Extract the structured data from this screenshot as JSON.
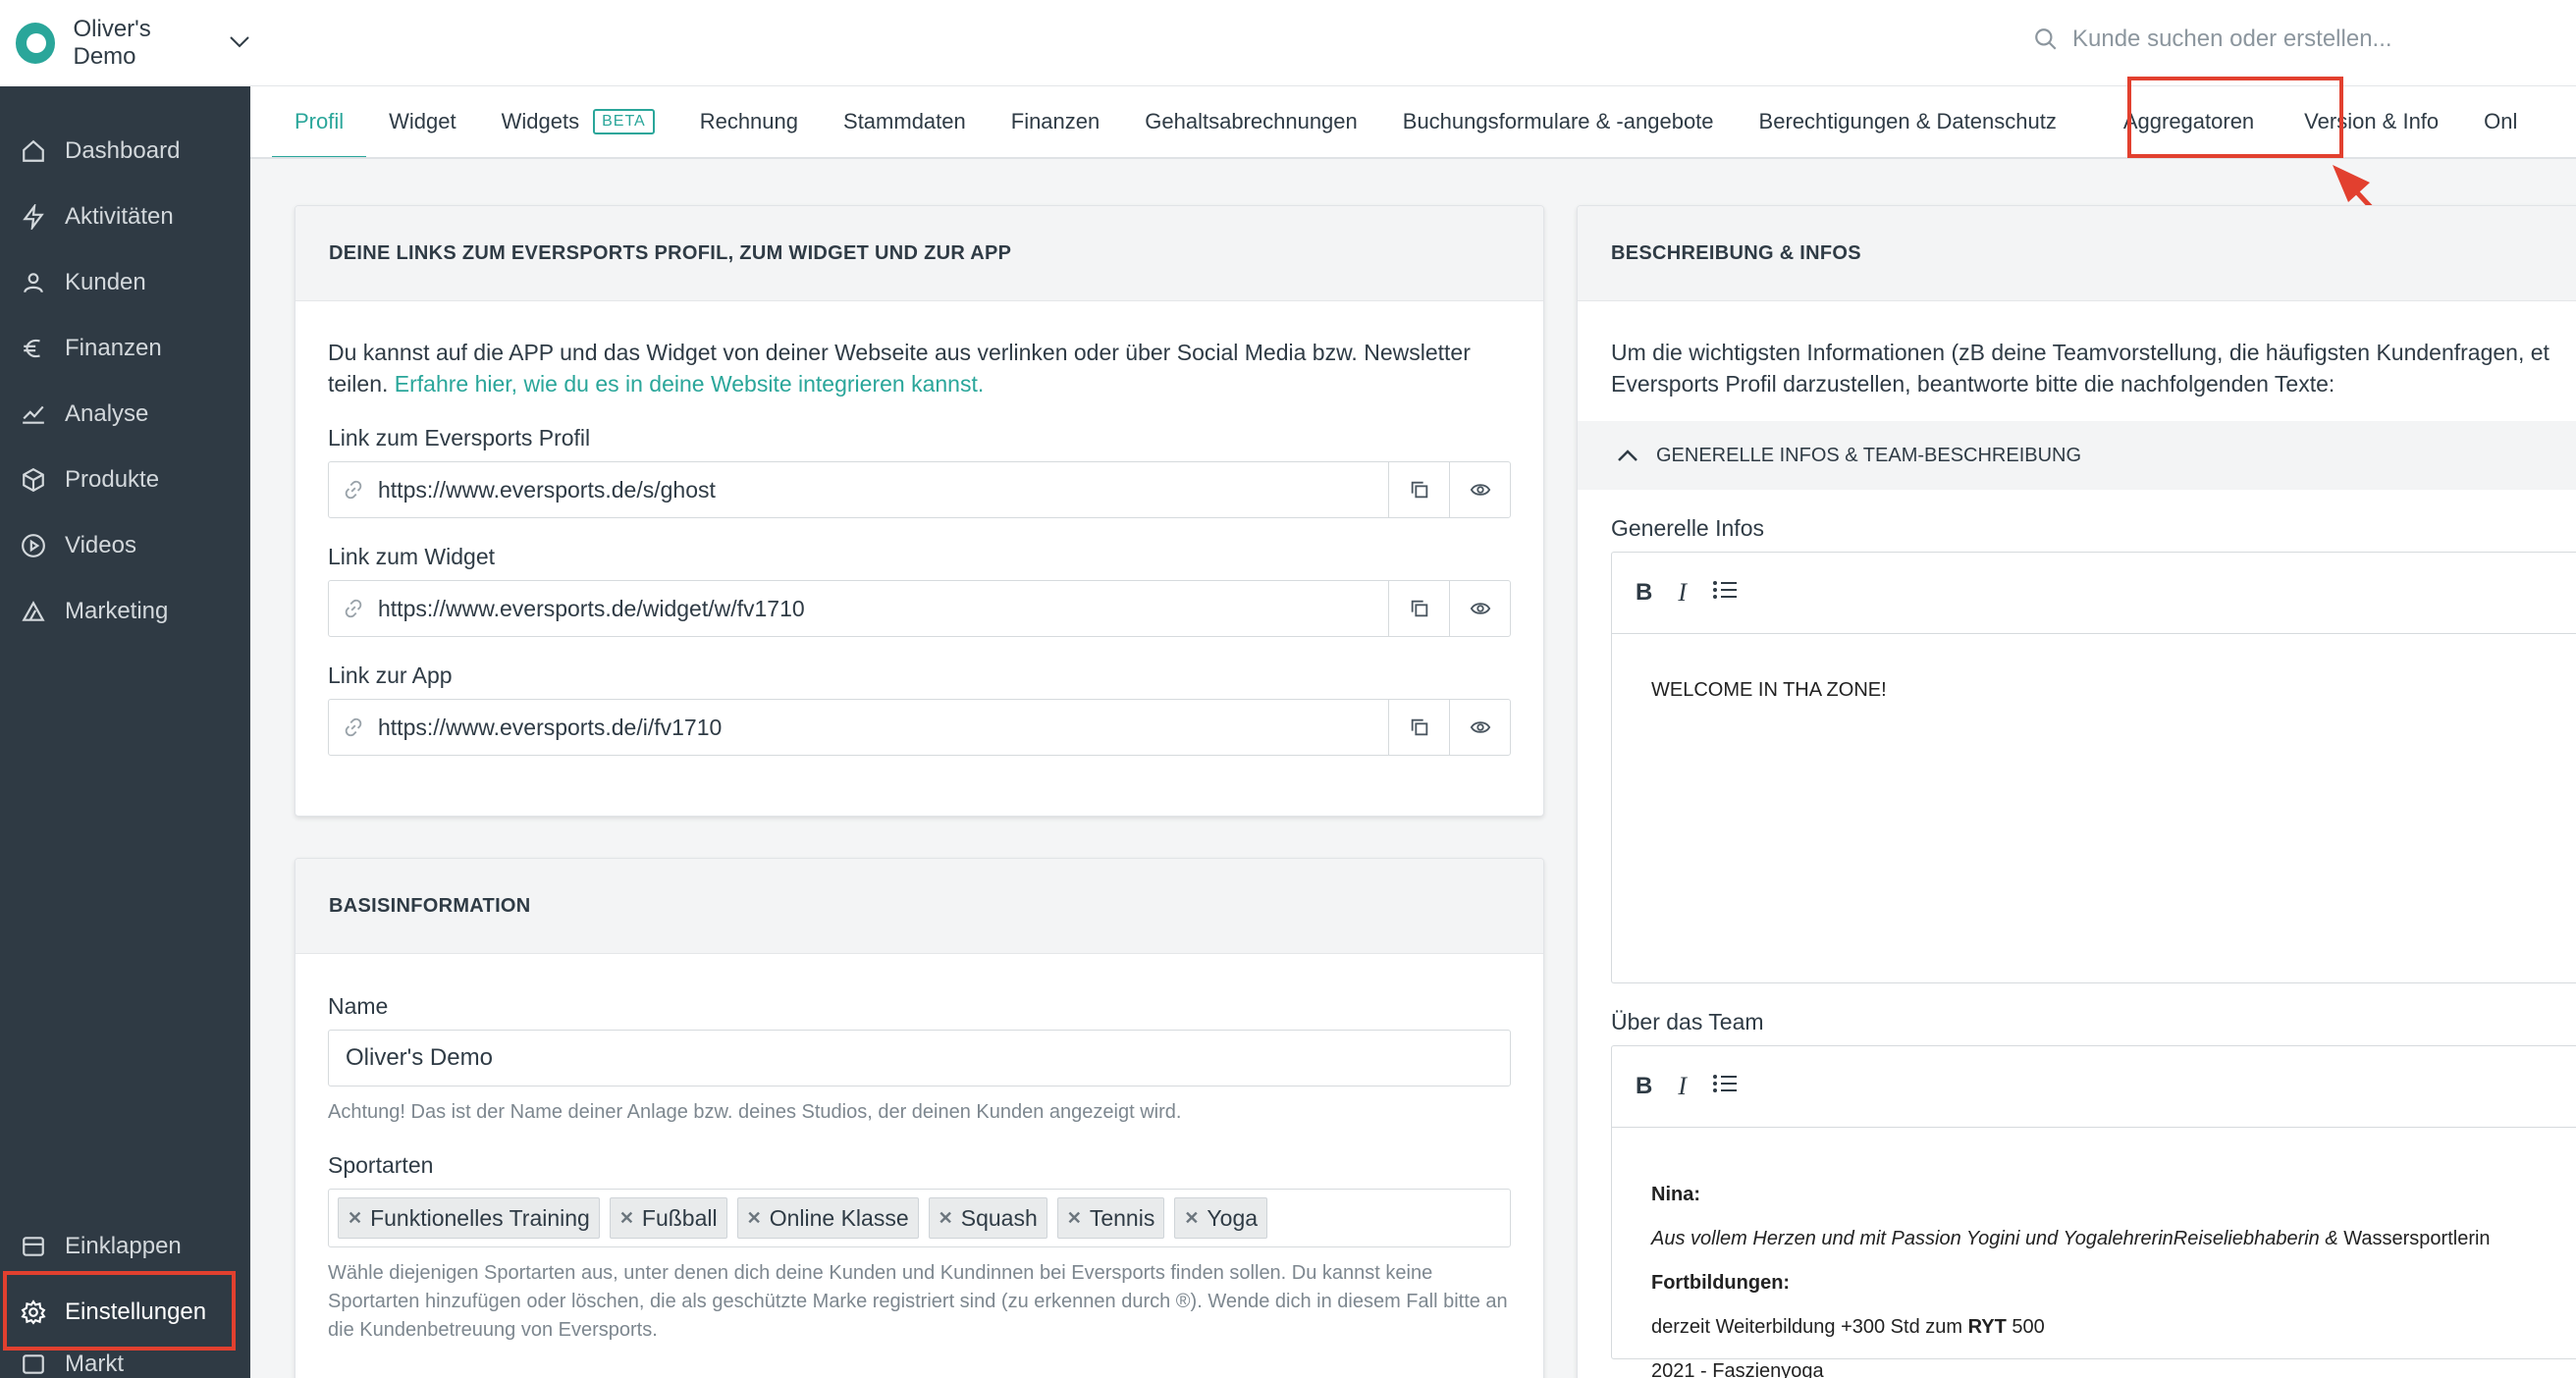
{
  "brand": {
    "name": "Oliver's Demo"
  },
  "search": {
    "placeholder": "Kunde suchen oder erstellen..."
  },
  "nav": {
    "items": [
      {
        "label": "Dashboard",
        "icon": "home-icon"
      },
      {
        "label": "Aktivitäten",
        "icon": "bolt-icon"
      },
      {
        "label": "Kunden",
        "icon": "user-icon"
      },
      {
        "label": "Finanzen",
        "icon": "euro-icon"
      },
      {
        "label": "Analyse",
        "icon": "chart-line-icon"
      },
      {
        "label": "Produkte",
        "icon": "box-icon"
      },
      {
        "label": "Videos",
        "icon": "play-icon"
      },
      {
        "label": "Marketing",
        "icon": "megaphone-icon"
      }
    ],
    "collapse": "Einklappen",
    "settings": "Einstellungen",
    "market": "Markt"
  },
  "tabs": [
    "Profil",
    "Widget",
    "Widgets",
    "Rechnung",
    "Stammdaten",
    "Finanzen",
    "Gehaltsabrechnungen",
    "Buchungsformulare & -angebote",
    "Berechtigungen & Datenschutz",
    "Aggregatoren",
    "Version & Info",
    "Onl"
  ],
  "beta_badge": "BETA",
  "links_card": {
    "title": "DEINE LINKS ZUM EVERSPORTS PROFIL, ZUM WIDGET UND ZUR APP",
    "intro": "Du kannst auf die APP und das Widget von deiner Webseite aus verlinken oder über Social Media bzw. Newsletter teilen.",
    "intro_link": "Erfahre hier, wie du es in deine Website integrieren kannst.",
    "fields": [
      {
        "label": "Link zum Eversports Profil",
        "value": "https://www.eversports.de/s/ghost"
      },
      {
        "label": "Link zum Widget",
        "value": "https://www.eversports.de/widget/w/fv1710"
      },
      {
        "label": "Link zur App",
        "value": "https://www.eversports.de/i/fv1710"
      }
    ]
  },
  "basis_card": {
    "title": "BASISINFORMATION",
    "name_label": "Name",
    "name_value": "Oliver's Demo",
    "name_hint": "Achtung! Das ist der Name deiner Anlage bzw. deines Studios, der deinen Kunden angezeigt wird.",
    "sports_label": "Sportarten",
    "sports": [
      "Funktionelles Training",
      "Fußball",
      "Online Klasse",
      "Squash",
      "Tennis",
      "Yoga"
    ],
    "sports_hint": "Wähle diejenigen Sportarten aus, unter denen dich deine Kunden und Kundinnen bei Eversports finden sollen. Du kannst keine Sportarten hinzufügen oder löschen, die als geschützte Marke registriert sind (zu erkennen durch ®). Wende dich in diesem Fall bitte an die Kundenbetreuung von Eversports."
  },
  "desc_card": {
    "title": "BESCHREIBUNG & INFOS",
    "intro": "Um die wichtigsten Informationen (zB deine Teamvorstellung, die häufigsten Kundenfragen, et",
    "intro2": "Eversports Profil darzustellen, beantworte bitte die nachfolgenden Texte:",
    "section": "GENERELLE INFOS & TEAM-BESCHREIBUNG",
    "general_label": "Generelle Infos",
    "general_text": "WELCOME IN THA ZONE!",
    "team_label": "Über das Team",
    "team_name": "Nina:",
    "team_desc": "Aus vollem Herzen und mit Passion Yogini und YogalehrerinReiseliebhaberin &",
    "team_desc_tail": "Wassersportlerin",
    "team_fort": "Fortbildungen:",
    "team_line1_pre": "derzeit Weiterbildung +300 Std zum",
    "team_line1_bold": "RYT",
    "team_line1_post": "500",
    "team_line2": "2021 - Faszienyoga"
  },
  "toolbar": {
    "bold": "B",
    "italic": "I"
  },
  "colors": {
    "accent": "#2aa69a",
    "sidebar": "#2f3a44",
    "highlight": "#e2402f"
  }
}
